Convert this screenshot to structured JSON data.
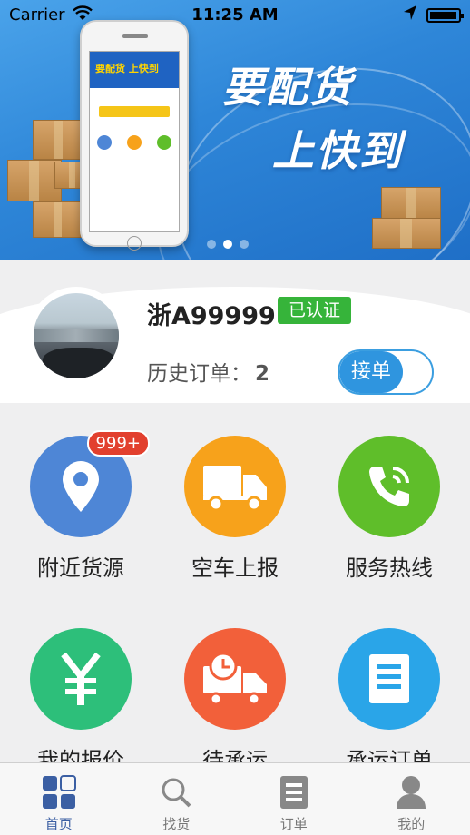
{
  "status_bar": {
    "carrier": "Carrier",
    "time": "11:25 AM"
  },
  "banner": {
    "slogan_line1": "要配货",
    "slogan_line2": "上快到",
    "phone_screen_title": "要配货 上快到",
    "page_count": 3,
    "active_page": 1
  },
  "profile": {
    "plate": "浙A99999",
    "verified_label": "已认证",
    "history_label": "历史订单：",
    "history_count": "2",
    "accept_toggle_label": "接单"
  },
  "grid": {
    "items": [
      {
        "label": "附近货源",
        "icon": "location-pin-icon",
        "color": "#4e86d6",
        "badge": "999+"
      },
      {
        "label": "空车上报",
        "icon": "truck-icon",
        "color": "#f7a21b"
      },
      {
        "label": "服务热线",
        "icon": "phone-icon",
        "color": "#5fbe2a"
      },
      {
        "label": "我的报价",
        "icon": "yen-icon",
        "color": "#2dbf7a"
      },
      {
        "label": "待承运",
        "icon": "clock-truck-icon",
        "color": "#f2603a"
      },
      {
        "label": "承运订单",
        "icon": "document-icon",
        "color": "#2aa5e8"
      }
    ]
  },
  "tabbar": {
    "tabs": [
      {
        "label": "首页",
        "icon": "home-grid-icon",
        "active": true
      },
      {
        "label": "找货",
        "icon": "search-icon",
        "active": false
      },
      {
        "label": "订单",
        "icon": "list-icon",
        "active": false
      },
      {
        "label": "我的",
        "icon": "user-icon",
        "active": false
      }
    ]
  }
}
